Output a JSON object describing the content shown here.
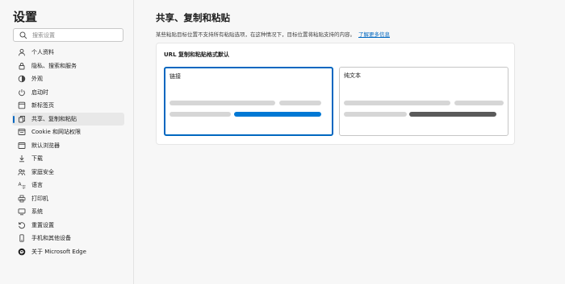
{
  "sidebar": {
    "title": "设置",
    "search_placeholder": "搜索设置",
    "items": [
      {
        "label": "个人资料"
      },
      {
        "label": "隐私、搜索和服务"
      },
      {
        "label": "外观"
      },
      {
        "label": "启动时"
      },
      {
        "label": "新标签页"
      },
      {
        "label": "共享、复制和粘贴"
      },
      {
        "label": "Cookie 和网站权限"
      },
      {
        "label": "默认浏览器"
      },
      {
        "label": "下载"
      },
      {
        "label": "家庭安全"
      },
      {
        "label": "语言"
      },
      {
        "label": "打印机"
      },
      {
        "label": "系统"
      },
      {
        "label": "重置设置"
      },
      {
        "label": "手机和其他设备"
      },
      {
        "label": "关于 Microsoft Edge"
      }
    ],
    "active_index": 5
  },
  "main": {
    "title": "共享、复制和粘贴",
    "description": "某些粘贴目标位置不支持所有粘贴选项，在这种情况下，目标位置将粘贴支持的内容。",
    "learn_more": "了解更多信息",
    "card": {
      "title": "URL 复制和粘贴格式默认",
      "options": [
        {
          "label": "链接",
          "selected": true
        },
        {
          "label": "纯文本",
          "selected": false
        }
      ]
    }
  },
  "colors": {
    "accent": "#0067c0",
    "link_bar": "#0078d4",
    "plain_bar": "#5a5a5a",
    "placeholder_bar": "#d6d6d6"
  }
}
